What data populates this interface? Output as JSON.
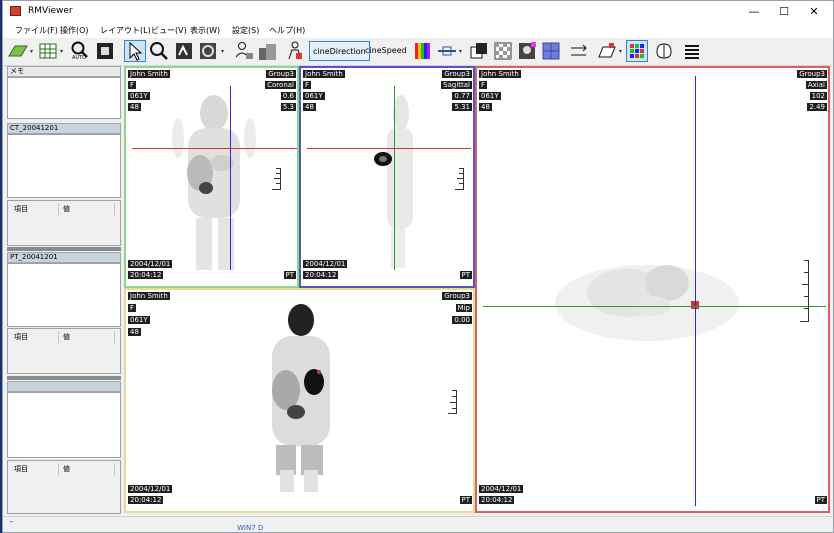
{
  "window": {
    "title": "RMViewer",
    "minimize": "—",
    "maximize": "☐",
    "close": "✕"
  },
  "menu": [
    "ファイル(F)",
    "操作(O)",
    "レイアウト(L)",
    "ビュー(V)",
    "表示(W)",
    "設定(S)",
    "ヘルプ(H)"
  ],
  "toolbar": {
    "cine_direction": "cineDirection",
    "cine_speed": "cineSpeed",
    "auto_label": "AUTO",
    "icons": [
      "shapes-icon",
      "layout-grid-icon",
      "zoom-auto-icon",
      "fit-window-icon",
      "pointer-icon",
      "zoom-icon",
      "window-level-icon",
      "rotate-icon",
      "patient-db-icon",
      "series-icon",
      "person-icon",
      "color-map-icon",
      "slice-icon",
      "overlay-icon",
      "checker-icon",
      "mip-icon",
      "fusion-icon",
      "measure-icon",
      "roi-icon",
      "sync-grid-icon",
      "brain-icon",
      "list-icon"
    ]
  },
  "sidebar": {
    "memo_label": "メモ",
    "ct_header": "CT_20041201",
    "pt_header": "PT_20041201",
    "col_item": "項目",
    "col_value": "値"
  },
  "viewports": {
    "coronal": {
      "name": "John Smith",
      "group": "Group3",
      "sex": "F",
      "view": "Coronal",
      "age": "061Y",
      "num": "48",
      "r1": "0.6",
      "r2": "5.3",
      "date": "2004/12/01",
      "time": "20:04:12",
      "modality": "PT",
      "border": "#8dd68a"
    },
    "sagittal": {
      "name": "John Smith",
      "group": "Group3",
      "sex": "F",
      "view": "Sagittal",
      "age": "061Y",
      "num": "48",
      "r1": "0.77",
      "r2": "5.31",
      "date": "2004/12/01",
      "time": "20:04:12",
      "modality": "PT",
      "border": "#5555c8"
    },
    "mip": {
      "name": "John Smith",
      "group": "Group3",
      "sex": "F",
      "view": "Mip",
      "age": "061Y",
      "num": "48",
      "r1": "0.00",
      "date": "2004/12/01",
      "time": "20:04:12",
      "modality": "PT",
      "border": "#e6dc9a"
    },
    "axial": {
      "name": "John Smith",
      "group": "Group3",
      "sex": "F",
      "view": "Axial",
      "age": "061Y",
      "num": "48",
      "r1": "102",
      "r2": "2.49",
      "date": "2004/12/01",
      "time": "20:04:12",
      "modality": "PT",
      "border": "#d86060"
    }
  },
  "taskbar_hint": "WIN7 D"
}
